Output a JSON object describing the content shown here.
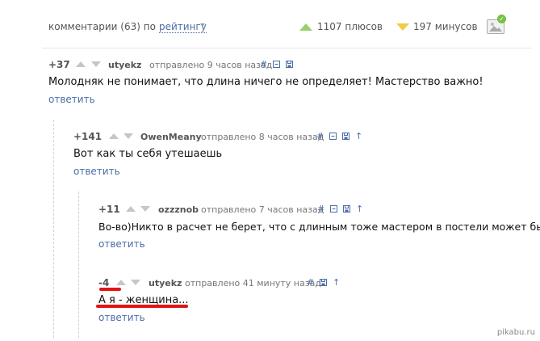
{
  "header": {
    "comments_label": "комментарии (63) по",
    "sort_label": "рейтингу",
    "plus_label": "1107 плюсов",
    "minus_label": "197 минусов"
  },
  "colors": {
    "link": "#4a6da7",
    "plus": "#9bd06e",
    "minus": "#f3cb45",
    "highlight": "#e01414"
  },
  "icons": [
    "hash-icon",
    "collapse-icon",
    "save-icon",
    "parent-arrow-icon",
    "image-toggle-icon",
    "checkmark-icon",
    "caret-down-icon"
  ],
  "comments": [
    {
      "rating": "+37",
      "user": "utyekz",
      "time": "отправлено 9 часов назад",
      "text": "Молодняк не понимает, что длина ничего не определяет! Мастерство важно!",
      "reply": "ответить"
    },
    {
      "rating": "+141",
      "user": "OwenMeany",
      "time": "отправлено 8 часов назад",
      "text": "Вот как ты себя утешаешь",
      "reply": "ответить"
    },
    {
      "rating": "+11",
      "user": "ozzznob",
      "time": "отправлено 7 часов назад",
      "text": "Во-во)Никто в расчет не берет, что с длинным тоже мастером в постели может быть))",
      "reply": "ответить"
    },
    {
      "rating": "-4",
      "user": "utyekz",
      "time": "отправлено 41 минуту назад",
      "text": "А я - женщина...",
      "reply": "ответить"
    }
  ],
  "watermark": "pikabu.ru"
}
